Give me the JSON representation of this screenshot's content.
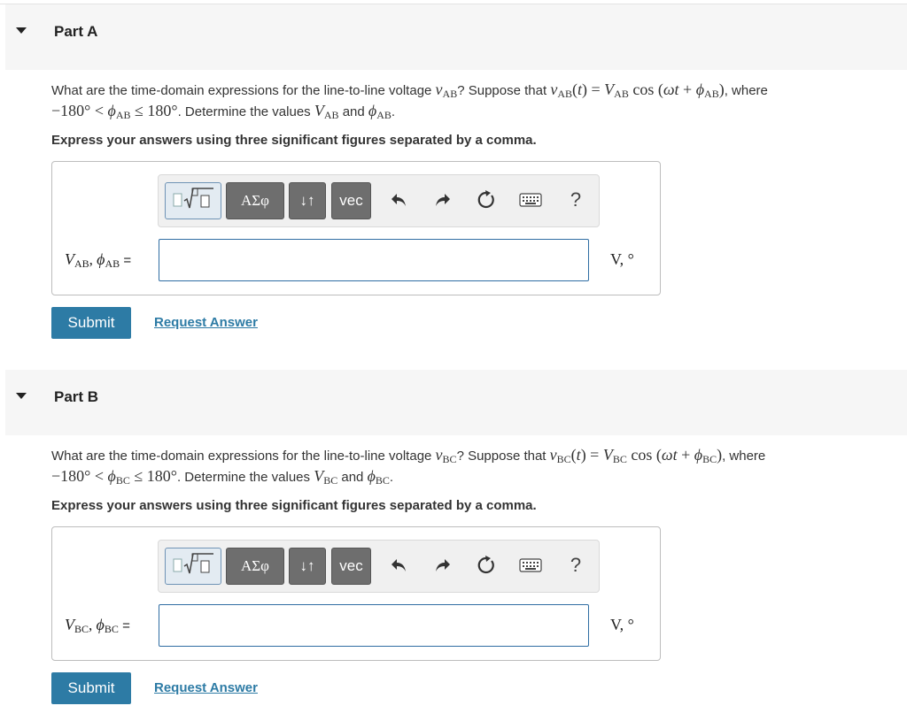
{
  "parts": [
    {
      "title": "Part A",
      "q_prefix": "What are the time-domain expressions for the line-to-line voltage",
      "q_sub": "AB",
      "q_suppose": "? Suppose that",
      "q_where": ", where",
      "q_determine": ". Determine the values",
      "q_and": "and",
      "instruction": "Express your answers using three significant figures separated by a comma.",
      "equals": "=",
      "units": "V, °",
      "answer_value": "",
      "submit_label": "Submit",
      "request_label": "Request Answer"
    },
    {
      "title": "Part B",
      "q_prefix": "What are the time-domain expressions for the line-to-line voltage",
      "q_sub": "BC",
      "q_suppose": "? Suppose that",
      "q_where": ", where",
      "q_determine": ". Determine the values",
      "q_and": "and",
      "instruction": "Express your answers using three significant figures separated by a comma.",
      "equals": "=",
      "units": "V, °",
      "answer_value": "",
      "submit_label": "Submit",
      "request_label": "Request Answer"
    }
  ],
  "toolbar": {
    "templates_icon": "fraction-sqrt-icon",
    "greek_label": "ΑΣφ",
    "arrows_label": "↓↑",
    "vec_label": "vec",
    "undo_icon": "undo-icon",
    "redo_icon": "redo-icon",
    "reset_icon": "reset-icon",
    "keyboard_icon": "keyboard-icon",
    "help_label": "?"
  },
  "colors": {
    "accent": "#2d7ba5",
    "toolbar_button": "#6e6e6e",
    "header_bg": "#f6f6f6"
  }
}
